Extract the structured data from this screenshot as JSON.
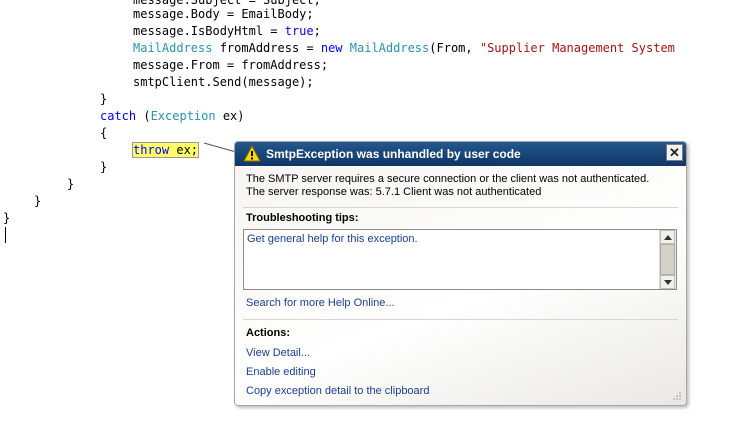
{
  "code": {
    "lines": [
      "message.Body = EmailBody;",
      "message.IsBodyHtml = true;",
      "MailAddress fromAddress = new MailAddress(From, \"Supplier Management System",
      "message.From = fromAddress;",
      "smtpClient.Send(message);",
      "}",
      "catch (Exception ex)",
      "{",
      "throw ex;",
      "}",
      "}",
      "}",
      "}"
    ]
  },
  "exception": {
    "title": "SmtpException was unhandled by user code",
    "message": "The SMTP server requires a secure connection or the client was not authenticated. The server response was: 5.7.1 Client was not authenticated",
    "tips_heading": "Troubleshooting tips:",
    "tips": [
      "Get general help for this exception."
    ],
    "search_link": "Search for more Help Online...",
    "actions_heading": "Actions:",
    "actions": [
      "View Detail...",
      "Enable editing",
      "Copy exception detail to the clipboard"
    ]
  },
  "icons": {
    "warning": "warning-icon",
    "close": "close-icon"
  },
  "colors": {
    "header_top": "#24588c",
    "header_bottom": "#0f3565",
    "keyword": "#0000ff",
    "type": "#2b91af",
    "string": "#a31515",
    "highlight": "#ffff66",
    "link": "#1b3f91"
  }
}
